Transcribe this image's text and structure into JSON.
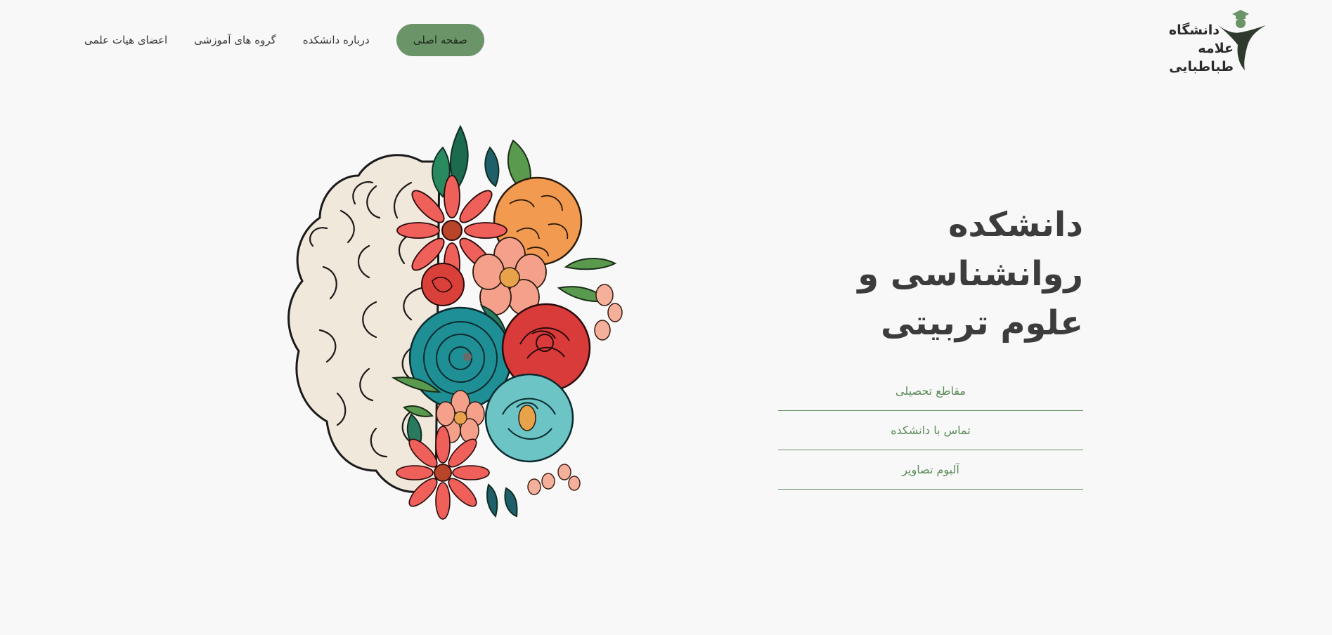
{
  "nav": {
    "items": [
      {
        "label": "صفحه اصلی",
        "active": true
      },
      {
        "label": "درباره دانشکده",
        "active": false
      },
      {
        "label": "گروه های آموزشی",
        "active": false
      },
      {
        "label": "اعضای هیات علمی",
        "active": false
      }
    ]
  },
  "logo": {
    "line1": "دانشگاه",
    "line2": "علامه طباطبایی",
    "icon": "graduate-figure-icon"
  },
  "hero": {
    "title_line1": "دانشکده روانشناسی و",
    "title_line2": "علوم تربیتی",
    "links": [
      "مقاطع تحصیلی",
      "تماس با دانشکده",
      "آلبوم تصاویر"
    ],
    "illustration": "brain-with-flowers-illustration"
  },
  "colors": {
    "accent": "#6b9469",
    "background": "#f8f8f8",
    "title": "#3c3c3c",
    "link": "#5a8a57"
  }
}
